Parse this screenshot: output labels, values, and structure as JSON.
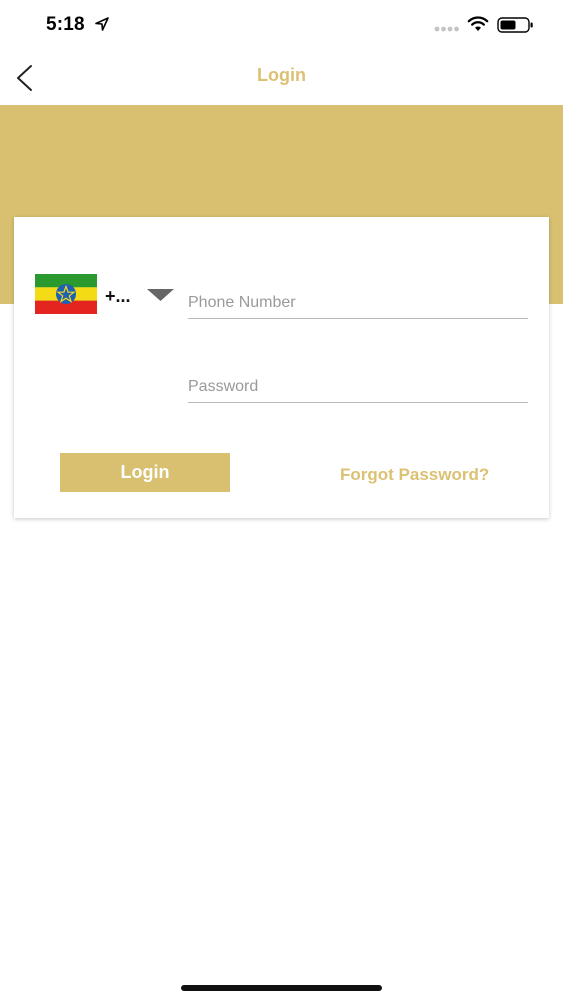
{
  "status_bar": {
    "time": "5:18",
    "icons": [
      "location-arrow-icon",
      "signal-dots-icon",
      "wifi-icon",
      "battery-icon"
    ]
  },
  "nav": {
    "title": "Login",
    "back_icon": "chevron-left-icon"
  },
  "login_form": {
    "country": {
      "flag_icon": "ethiopia-flag-icon",
      "dial_code": "+...",
      "dropdown_icon": "caret-down-icon"
    },
    "phone": {
      "value": "",
      "placeholder": "Phone Number"
    },
    "password": {
      "value": "",
      "placeholder": "Password"
    },
    "login_label": "Login",
    "forgot_label": "Forgot Password?"
  },
  "colors": {
    "accent": "#d8c070",
    "accent_text": "#dcc173",
    "background": "#ffffff"
  }
}
